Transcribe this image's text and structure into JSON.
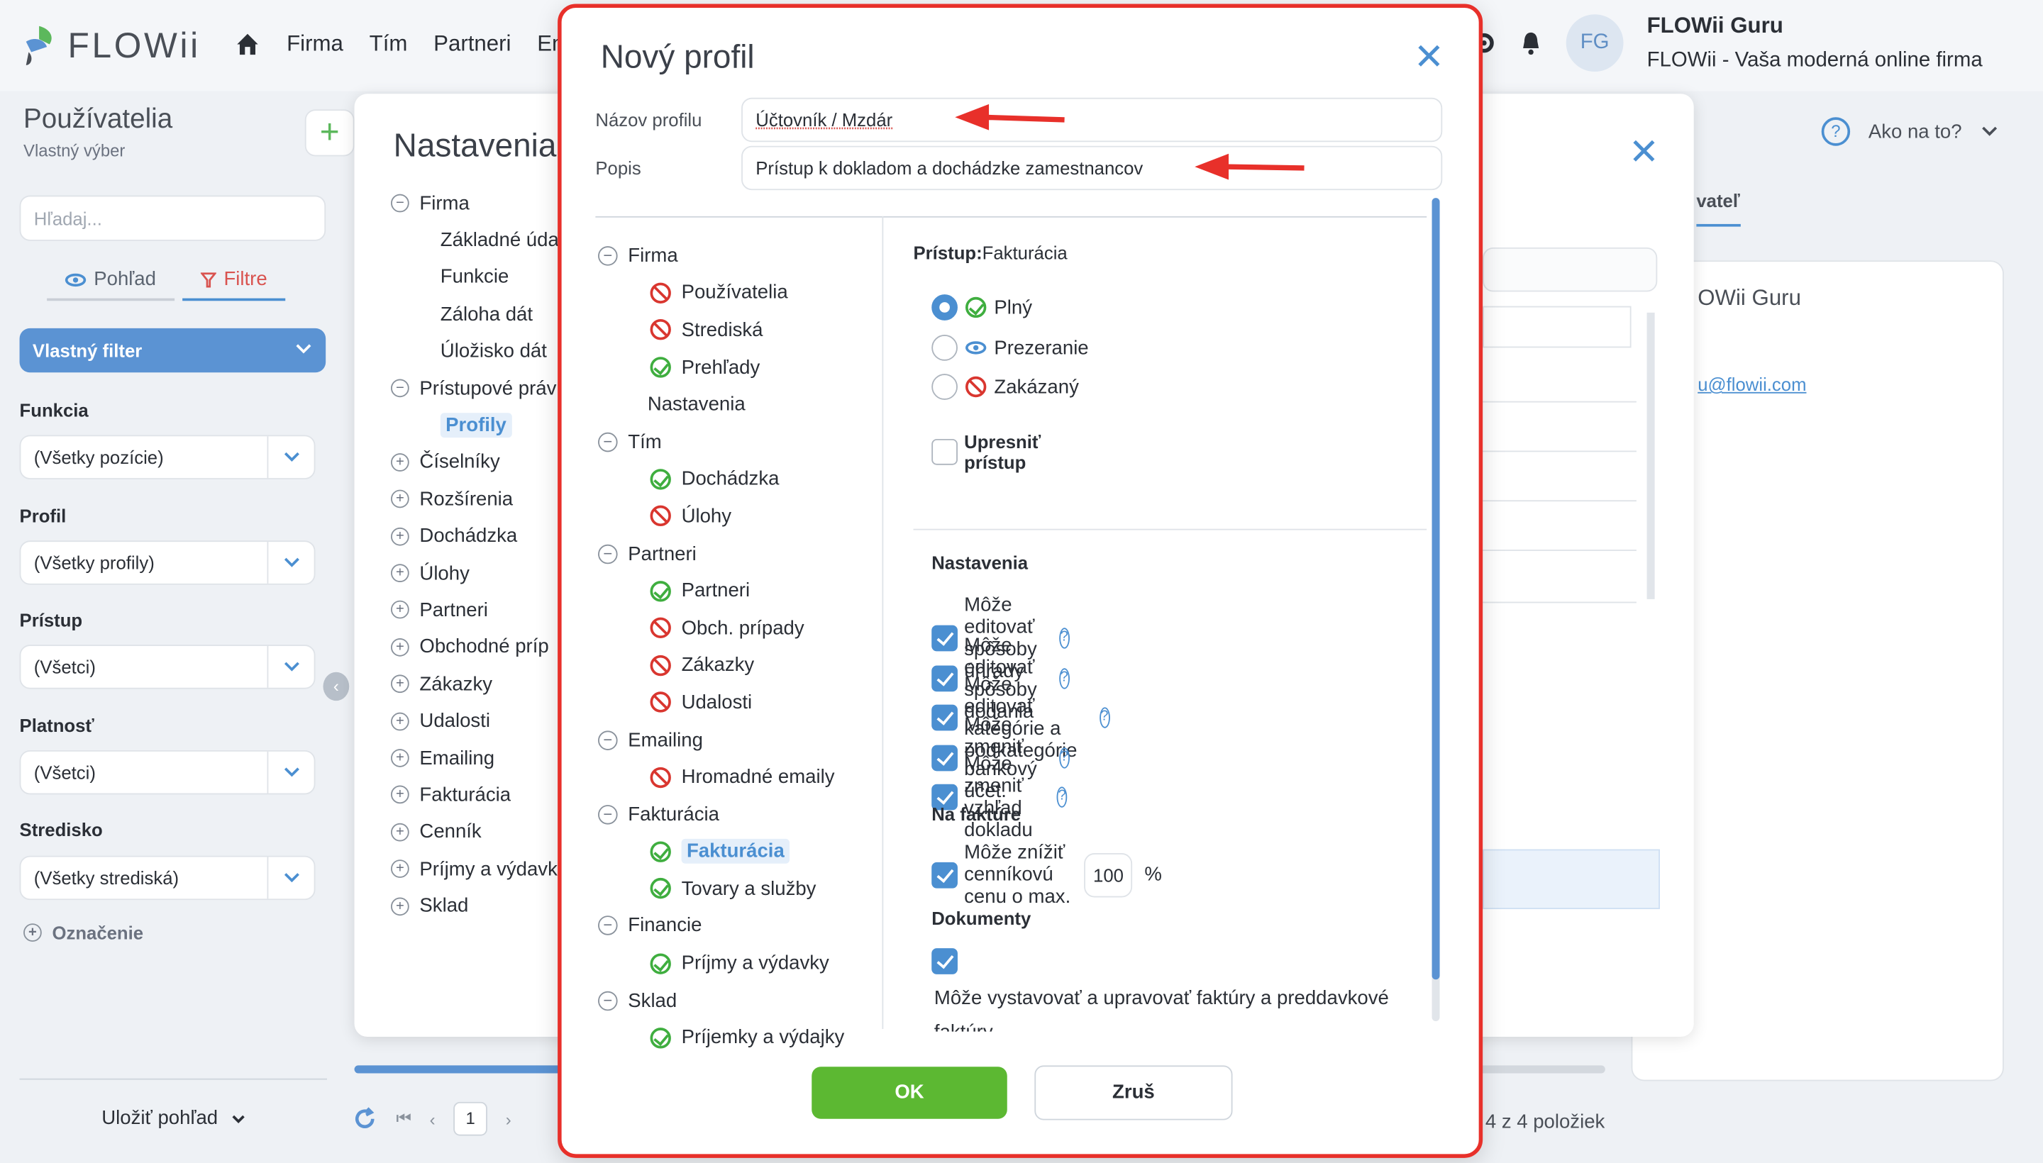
{
  "app": {
    "logo": "FLOWii"
  },
  "nav": {
    "items": [
      "Firma",
      "Tím",
      "Partneri",
      "Ema"
    ]
  },
  "user": {
    "initials": "FG",
    "name": "FLOWii Guru",
    "company": "FLOWii - Vaša moderná online firma"
  },
  "sidebar": {
    "title": "Používatelia",
    "subtitle": "Vlastný výber",
    "search_placeholder": "Hľadaj...",
    "tab_view": "Pohľad",
    "tab_filters": "Filtre",
    "custom_filter": "Vlastný filter",
    "filters": [
      {
        "label": "Funkcia",
        "value": "(Všetky pozície)"
      },
      {
        "label": "Profil",
        "value": "(Všetky profily)"
      },
      {
        "label": "Prístup",
        "value": "(Všetci)"
      },
      {
        "label": "Platnosť",
        "value": "(Všetci)"
      },
      {
        "label": "Stredisko",
        "value": "(Všetky strediská)"
      }
    ],
    "marking": "Označenie",
    "save_view": "Uložiť pohľad"
  },
  "background": {
    "help": "Ako na to?",
    "tab_partial": "vateľ",
    "card_name": "OWii Guru",
    "card_email": "u@flowii.com",
    "page": "1",
    "count": "4 z 4 položiek"
  },
  "settings_modal": {
    "title": "Nastavenia",
    "tree": [
      {
        "label": "Firma",
        "level": 0,
        "marker": "minus"
      },
      {
        "label": "Základné úda",
        "level": 1
      },
      {
        "label": "Funkcie",
        "level": 1
      },
      {
        "label": "Záloha dát",
        "level": 1
      },
      {
        "label": "Úložisko dát",
        "level": 1
      },
      {
        "label": "Prístupové práv",
        "level": 0,
        "marker": "minus"
      },
      {
        "label": "Profily",
        "level": 1,
        "selected": true
      },
      {
        "label": "Číselníky",
        "level": 0,
        "marker": "plus"
      },
      {
        "label": "Rozšírenia",
        "level": 0,
        "marker": "plus"
      },
      {
        "label": "Dochádzka",
        "level": 0,
        "marker": "plus"
      },
      {
        "label": "Úlohy",
        "level": 0,
        "marker": "plus"
      },
      {
        "label": "Partneri",
        "level": 0,
        "marker": "plus"
      },
      {
        "label": "Obchodné príp",
        "level": 0,
        "marker": "plus"
      },
      {
        "label": "Zákazky",
        "level": 0,
        "marker": "plus"
      },
      {
        "label": "Udalosti",
        "level": 0,
        "marker": "plus"
      },
      {
        "label": "Emailing",
        "level": 0,
        "marker": "plus"
      },
      {
        "label": "Fakturácia",
        "level": 0,
        "marker": "plus"
      },
      {
        "label": "Cenník",
        "level": 0,
        "marker": "plus"
      },
      {
        "label": "Príjmy a výdavk",
        "level": 0,
        "marker": "plus"
      },
      {
        "label": "Sklad",
        "level": 0,
        "marker": "plus"
      }
    ]
  },
  "profile_modal": {
    "title": "Nový profil",
    "name_label": "Názov profilu",
    "name_value": "Účtovník / Mzdár",
    "desc_label": "Popis",
    "desc_value": "Prístup k dokladom a dochádzke zamestnancov",
    "tree": [
      {
        "label": "Firma",
        "kind": "group"
      },
      {
        "label": "Používatelia",
        "kind": "ban"
      },
      {
        "label": "Strediská",
        "kind": "ban"
      },
      {
        "label": "Prehľady",
        "kind": "ok"
      },
      {
        "label": "Nastavenia",
        "kind": "none"
      },
      {
        "label": "Tím",
        "kind": "group"
      },
      {
        "label": "Dochádzka",
        "kind": "ok"
      },
      {
        "label": "Úlohy",
        "kind": "ban"
      },
      {
        "label": "Partneri",
        "kind": "group"
      },
      {
        "label": "Partneri",
        "kind": "ok"
      },
      {
        "label": "Obch. prípady",
        "kind": "ban"
      },
      {
        "label": "Zákazky",
        "kind": "ban"
      },
      {
        "label": "Udalosti",
        "kind": "ban"
      },
      {
        "label": "Emailing",
        "kind": "group"
      },
      {
        "label": "Hromadné emaily",
        "kind": "ban"
      },
      {
        "label": "Fakturácia",
        "kind": "group"
      },
      {
        "label": "Fakturácia",
        "kind": "ok",
        "selected": true
      },
      {
        "label": "Tovary a služby",
        "kind": "ok"
      },
      {
        "label": "Financie",
        "kind": "group"
      },
      {
        "label": "Príjmy a výdavky",
        "kind": "ok"
      },
      {
        "label": "Sklad",
        "kind": "group"
      },
      {
        "label": "Príjemky a výdajky",
        "kind": "ok"
      }
    ],
    "access_prefix": "Prístup:",
    "access_section": "Fakturácia",
    "radio_full": "Plný",
    "radio_view": "Prezeranie",
    "radio_denied": "Zakázaný",
    "refine_access": "Upresniť prístup",
    "settings_title": "Nastavenia",
    "settings_items": [
      "Môže editovať spôsoby úhrady",
      "Môže editovať spôsoby dodania",
      "Môže editovať kategórie a podkategórie",
      "Môže zmeniť bankový účet.",
      "Môže zmeniť vzhľad dokladu"
    ],
    "invoice_title": "Na faktúre",
    "invoice_item": "Môže znížiť cenníkovú cenu o max.",
    "invoice_value": "100",
    "invoice_unit": "%",
    "documents_title": "Dokumenty",
    "documents_item": "Môže vystavovať a upravovať faktúry a preddavkové faktúry",
    "ok": "OK",
    "cancel": "Zruš"
  },
  "colors": {
    "accent": "#4b8fd1",
    "ok": "#5cb832",
    "highlight": "#e8302a"
  }
}
